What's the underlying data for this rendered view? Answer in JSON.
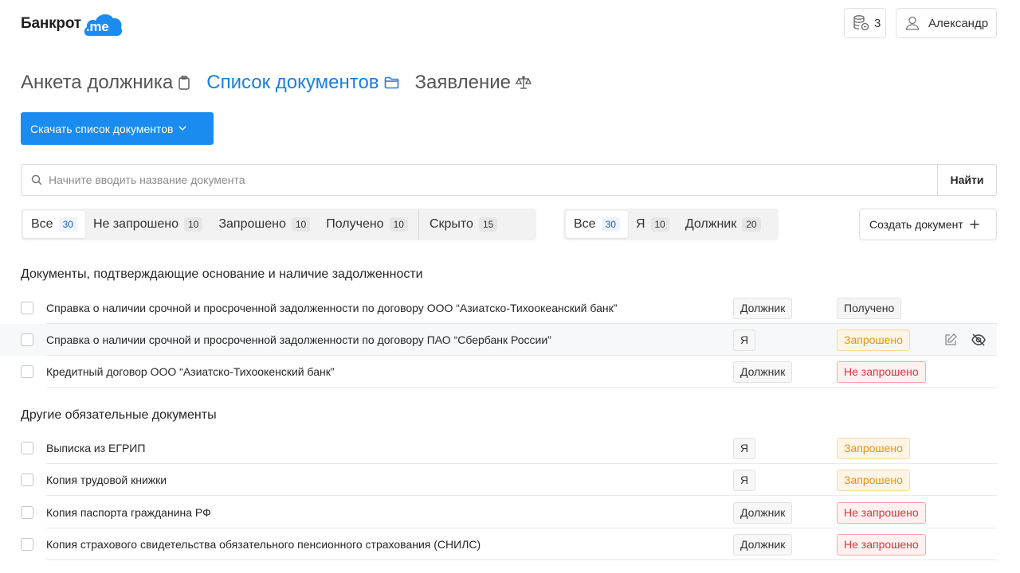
{
  "header": {
    "logo_text": "Банкрот",
    "logo_suffix": ".me",
    "coins_count": "3",
    "user_name": "Александр"
  },
  "page_tabs": [
    {
      "label": "Анкета должника",
      "icon": "clipboard-icon",
      "active": false
    },
    {
      "label": "Список документов",
      "icon": "folder-icon",
      "active": true
    },
    {
      "label": "Заявление",
      "icon": "scales-icon",
      "active": false
    }
  ],
  "download_button": {
    "label": "Скачать список документов"
  },
  "search": {
    "placeholder": "Начните вводить название документа",
    "value": "",
    "button_label": "Найти"
  },
  "status_filters": [
    {
      "label": "Все",
      "count": "30",
      "active": true
    },
    {
      "label": "Не запрошено",
      "count": "10",
      "active": false
    },
    {
      "label": "Запрошено",
      "count": "10",
      "active": false
    },
    {
      "label": "Получено",
      "count": "10",
      "active": false
    },
    {
      "label": "Скрыто",
      "count": "15",
      "active": false
    }
  ],
  "owner_filters": [
    {
      "label": "Все",
      "count": "30",
      "active": true
    },
    {
      "label": "Я",
      "count": "10",
      "active": false
    },
    {
      "label": "Должник",
      "count": "20",
      "active": false
    }
  ],
  "create_button": {
    "label": "Создать документ",
    "icon": "plus-icon"
  },
  "sections": [
    {
      "title": "Документы, подтверждающие основание и наличие задолженности",
      "rows": [
        {
          "name": "Справка о наличии срочной и просроченной задолженности по договору ООО “Азиатско-Тихоокеанский банк”",
          "who": "Должник",
          "status": "Получено",
          "status_kind": "got"
        },
        {
          "name": "Справка о наличии срочной и просроченной задолженности по договору ПАО “Сбербанк России”",
          "who": "Я",
          "status": "Запрошено",
          "status_kind": "req"
        },
        {
          "name": "Кредитный договор ООО “Азиатско-Тихоокенский банк”",
          "who": "Должник",
          "status": "Не запрошено",
          "status_kind": "not"
        }
      ]
    },
    {
      "title": "Другие обязательные документы",
      "rows": [
        {
          "name": "Выписка из ЕГРИП",
          "who": "Я",
          "status": "Запрошено",
          "status_kind": "req"
        },
        {
          "name": "Копия трудовой книжки",
          "who": "Я",
          "status": "Запрошено",
          "status_kind": "req"
        },
        {
          "name": "Копия паспорта гражданина РФ",
          "who": "Должник",
          "status": "Не запрошено",
          "status_kind": "not"
        },
        {
          "name": "Копия страхового свидетельства обязательного пенсионного страхования (СНИЛС)",
          "who": "Должник",
          "status": "Не запрошено",
          "status_kind": "not"
        }
      ]
    }
  ],
  "row_actions": {
    "edit_icon": "edit-icon",
    "hide_icon": "eye-off-icon"
  },
  "colors": {
    "accent": "#1a8cf0",
    "active_tab": "#1a7fe0",
    "requested": "#e8930c",
    "not_requested": "#d9363e"
  }
}
